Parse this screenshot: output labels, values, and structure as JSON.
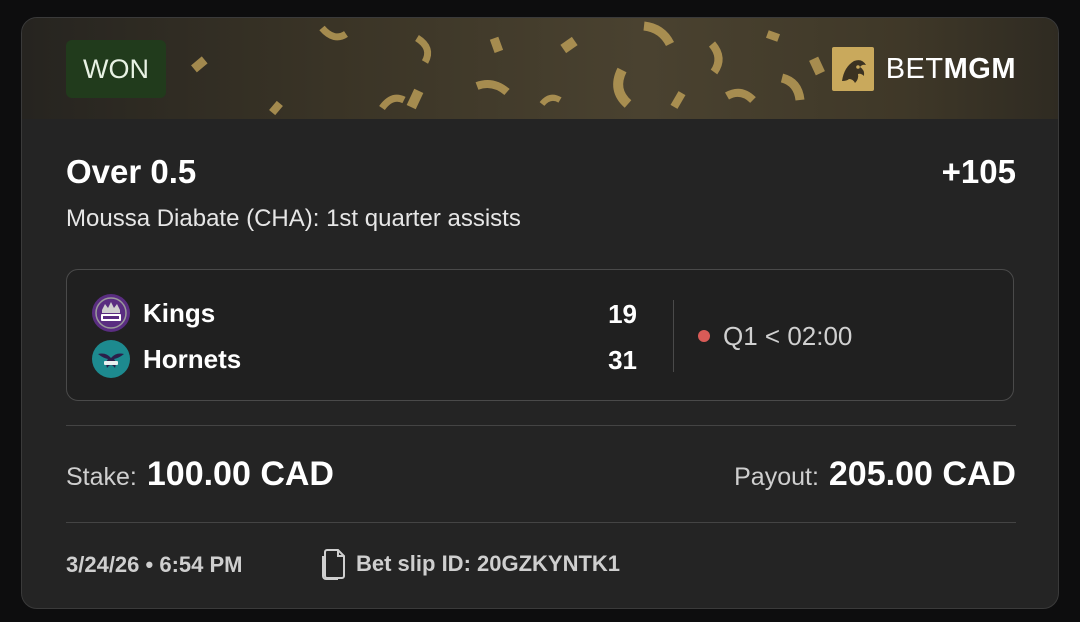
{
  "status_badge": "WON",
  "brand": {
    "name_light": "BET",
    "name_bold": "MGM"
  },
  "bet": {
    "selection": "Over 0.5",
    "odds": "+105",
    "market": "Moussa Diabate (CHA): 1st quarter assists"
  },
  "game": {
    "teams": [
      {
        "name": "Kings",
        "score": "19",
        "logo_color": "#5a2d81"
      },
      {
        "name": "Hornets",
        "score": "31",
        "logo_color": "#1d8a8f"
      }
    ],
    "status": "Q1 < 02:00",
    "live_color": "#d85b57"
  },
  "stake": {
    "label": "Stake:",
    "value": "100.00 CAD"
  },
  "payout": {
    "label": "Payout:",
    "value": "205.00 CAD"
  },
  "footer": {
    "date": "3/24/26 • 6:54 PM",
    "slip_id_text": "Bet slip ID: 20GZKYNTK1"
  },
  "icons": {
    "brand": "lion-logo-icon",
    "kings": "kings-logo-icon",
    "hornets": "hornets-logo-icon",
    "live": "live-dot-icon",
    "slip": "document-icon"
  },
  "colors": {
    "card_bg": "#242424",
    "won_bg": "#213b1c",
    "gold": "#c9a95c"
  }
}
